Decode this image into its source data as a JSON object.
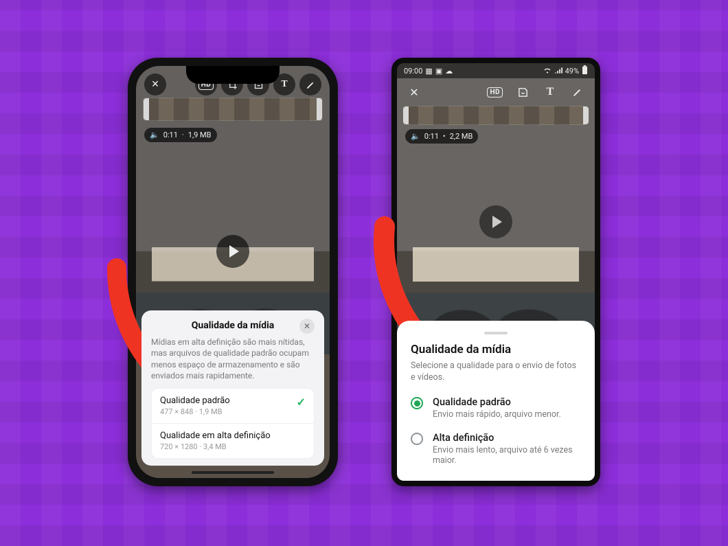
{
  "background": {
    "accent": "#8c2ed9"
  },
  "annotation": {
    "arrow_color": "#ef3323"
  },
  "iphone": {
    "editor": {
      "tools": {
        "close": "close-icon",
        "hd": "HD",
        "crop": "crop-icon",
        "sticker": "sticker-icon",
        "text": "T",
        "draw": "draw-icon"
      },
      "meta": {
        "duration": "0:11",
        "size": "1,9 MB"
      }
    },
    "sheet": {
      "title": "Qualidade da mídia",
      "close": "✕",
      "description": "Mídias em alta definição são mais nítidas, mas arquivos de qualidade padrão ocupam menos espaço de armazenamento e são enviados mais rapidamente.",
      "options": [
        {
          "title": "Qualidade padrão",
          "subtitle": "477 × 848 · 1,9 MB",
          "selected": true
        },
        {
          "title": "Qualidade em alta definição",
          "subtitle": "720 × 1280 · 3,4 MB",
          "selected": false
        }
      ]
    }
  },
  "android": {
    "status": {
      "time": "09:00",
      "left_icons": [
        "sim-icon",
        "photo-icon",
        "cloud-icon"
      ],
      "right": {
        "wifi": "wifi-icon",
        "signal": "signal-icon",
        "battery_pct": "49%"
      }
    },
    "editor": {
      "tools": {
        "close": "close-icon",
        "hd": "HD",
        "sticker": "sticker-icon",
        "text": "T",
        "draw": "draw-icon"
      },
      "meta": {
        "duration": "0:11",
        "size": "2,2 MB",
        "sep": "•"
      }
    },
    "sheet": {
      "title": "Qualidade da mídia",
      "description": "Selecione a qualidade para o envio de fotos e vídeos.",
      "options": [
        {
          "title": "Qualidade padrão",
          "subtitle": "Envio mais rápido, arquivo menor.",
          "selected": true
        },
        {
          "title": "Alta definição",
          "subtitle": "Envio mais lento, arquivo até 6 vezes maior.",
          "selected": false
        }
      ]
    }
  }
}
